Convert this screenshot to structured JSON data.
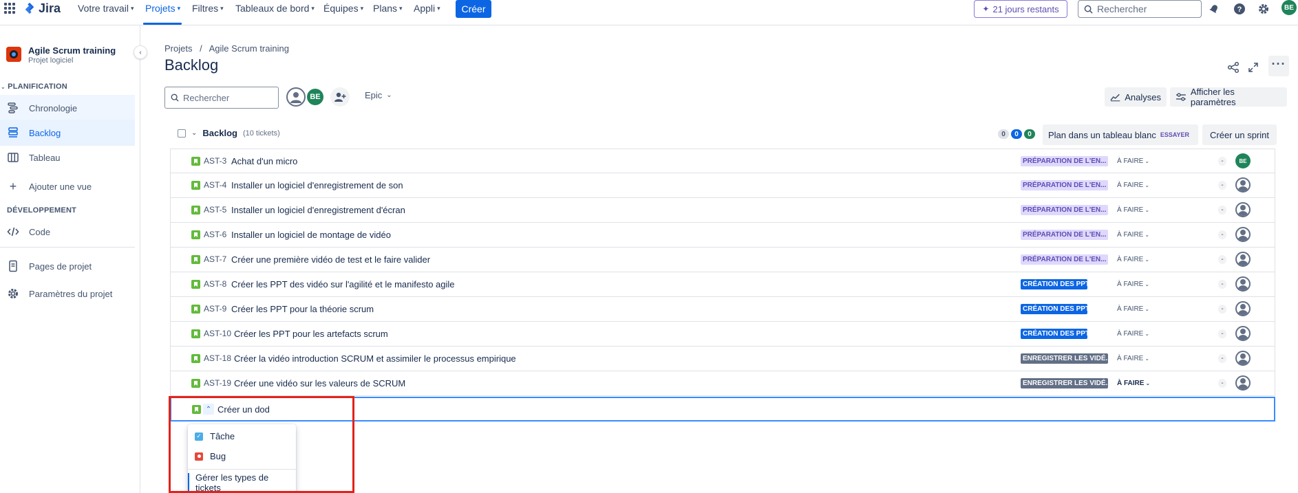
{
  "topnav": {
    "logo_text": "Jira",
    "items": [
      "Votre travail",
      "Projets",
      "Filtres",
      "Tableaux de bord",
      "Équipes",
      "Plans",
      "Appli"
    ],
    "create_label": "Créer",
    "trial_label": "21 jours restants",
    "search_placeholder": "Rechercher",
    "user_initials": "BE",
    "accent_color": "#0c66e4"
  },
  "sidebar": {
    "project_name": "Agile Scrum training",
    "project_type": "Projet logiciel",
    "section_planning": "PLANIFICATION",
    "planning_items": [
      "Chronologie",
      "Backlog",
      "Tableau",
      "Ajouter une vue"
    ],
    "section_dev": "DÉVELOPPEMENT",
    "dev_items": [
      "Code"
    ],
    "bottom_items": [
      "Pages de projet",
      "Paramètres du projet"
    ]
  },
  "main": {
    "breadcrumb_root": "Projets",
    "breadcrumb_sep": "/",
    "breadcrumb_project": "Agile Scrum training",
    "title": "Backlog",
    "search_placeholder": "Rechercher",
    "avatar_initials": "BE",
    "epic_filter": "Epic",
    "insights_label": "Analyses",
    "settings_label": "Afficher les paramètres"
  },
  "backlog": {
    "label": "Backlog",
    "count_text": "(10 tickets)",
    "counts": [
      "0",
      "0",
      "0"
    ],
    "plan_label": "Plan dans un tableau blanc",
    "try_label": "ESSAYER",
    "create_sprint_label": "Créer un sprint",
    "dash": "-",
    "rows": [
      {
        "key": "AST-3",
        "summary": "Achat d'un micro",
        "epic": "PRÉPARATION DE L'EN...",
        "status": "À FAIRE",
        "assignee": "BE"
      },
      {
        "key": "AST-4",
        "summary": "Installer un logiciel d'enregistrement de son",
        "epic": "PRÉPARATION DE L'EN...",
        "status": "À FAIRE",
        "assignee": ""
      },
      {
        "key": "AST-5",
        "summary": "Installer un logiciel d'enregistrement d'écran",
        "epic": "PRÉPARATION DE L'EN...",
        "status": "À FAIRE",
        "assignee": ""
      },
      {
        "key": "AST-6",
        "summary": "Installer un logiciel de montage de vidéo",
        "epic": "PRÉPARATION DE L'EN...",
        "status": "À FAIRE",
        "assignee": ""
      },
      {
        "key": "AST-7",
        "summary": "Créer une première vidéo de test et le faire valider",
        "epic": "PRÉPARATION DE L'EN...",
        "status": "À FAIRE",
        "assignee": ""
      },
      {
        "key": "AST-8",
        "summary": "Créer les PPT des vidéo sur l'agilité et le manifesto agile",
        "epic": "CRÉATION DES PPT",
        "status": "À FAIRE",
        "assignee": ""
      },
      {
        "key": "AST-9",
        "summary": "Créer les PPT pour la théorie scrum",
        "epic": "CRÉATION DES PPT",
        "status": "À FAIRE",
        "assignee": ""
      },
      {
        "key": "AST-10",
        "summary": "Créer les PPT pour les artefacts scrum",
        "epic": "CRÉATION DES PPT",
        "status": "À FAIRE",
        "assignee": ""
      },
      {
        "key": "AST-18",
        "summary": "Créer la vidéo introduction SCRUM et assimiler le processus empirique",
        "epic": "ENREGISTRER LES VIDÉ...",
        "status": "À FAIRE",
        "assignee": ""
      },
      {
        "key": "AST-19",
        "summary": "Créer une vidéo sur les valeurs de SCRUM",
        "epic": "ENREGISTRER LES VIDÉ...",
        "status": "À FAIRE",
        "assignee": ""
      }
    ],
    "create_input_value": "Créer un dod",
    "type_options": [
      "Tâche",
      "Bug"
    ],
    "manage_types_label": "Gérer les types de tickets"
  }
}
